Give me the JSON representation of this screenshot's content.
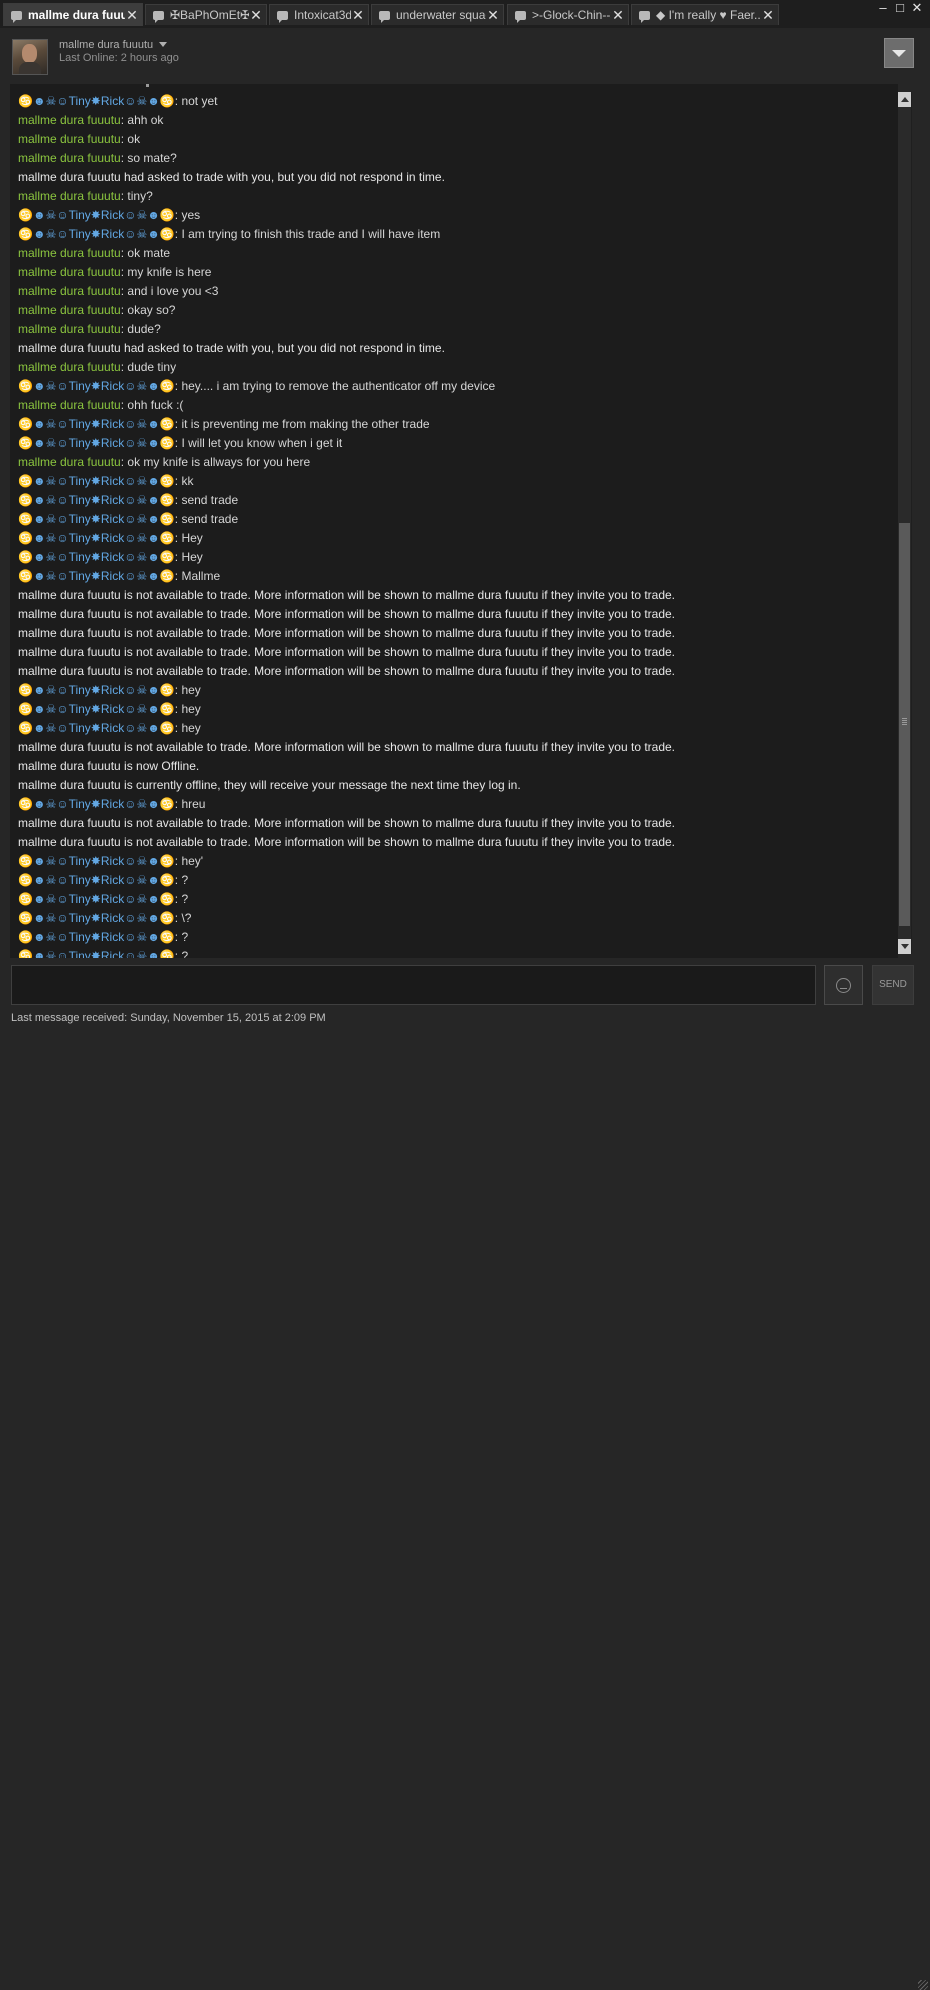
{
  "tabs": [
    {
      "label": "mallme dura fuuutu",
      "active": true
    },
    {
      "label": "✠BaPhOmEt✠",
      "active": false
    },
    {
      "label": "Intoxicat3d",
      "active": false
    },
    {
      "label": "underwater squad",
      "active": false
    },
    {
      "label": ">-Glock-Chin-->",
      "active": false
    },
    {
      "label": "◆ I'm really ♥ Faer...",
      "active": false
    }
  ],
  "window": {
    "minimize": "–",
    "maximize": "□",
    "close": "✕"
  },
  "header": {
    "friend_name": "mallme dura fuuutu",
    "last_online": "Last Online: 2 hours ago"
  },
  "speakers": {
    "friend": "mallme dura fuuutu",
    "me": "♋☻☠☺Tiny✸Rick☺☠☻♋"
  },
  "colors": {
    "friend_name": "#8bc53f",
    "self_name": "#62a7e3",
    "message_text": "#d6d6d6",
    "background": "#1c1c1c"
  },
  "messages": [
    {
      "type": "me",
      "text": ": not yet"
    },
    {
      "type": "friend",
      "text": ": ahh ok"
    },
    {
      "type": "friend",
      "text": ": ok"
    },
    {
      "type": "friend",
      "text": ": so mate?"
    },
    {
      "type": "event",
      "text": "mallme dura fuuutu had asked to trade with you, but you did not respond in time."
    },
    {
      "type": "friend",
      "text": ": tiny?"
    },
    {
      "type": "me",
      "text": ": yes"
    },
    {
      "type": "me",
      "text": ": I am trying to finish this trade and I will have item"
    },
    {
      "type": "friend",
      "text": ": ok mate"
    },
    {
      "type": "friend",
      "text": ": my knife is here"
    },
    {
      "type": "friend",
      "text": ": and i love you <3"
    },
    {
      "type": "friend",
      "text": ": okay so?"
    },
    {
      "type": "friend",
      "text": ": dude?"
    },
    {
      "type": "event",
      "text": "mallme dura fuuutu had asked to trade with you, but you did not respond in time."
    },
    {
      "type": "friend",
      "text": ": dude tiny"
    },
    {
      "type": "me",
      "text": ": hey.... i am trying to remove the authenticator off my device"
    },
    {
      "type": "friend",
      "text": ": ohh fuck :("
    },
    {
      "type": "me",
      "text": ": it is  preventing me from making the other trade"
    },
    {
      "type": "me",
      "text": ": I will let you know when i get it"
    },
    {
      "type": "friend",
      "text": ": ok my knife is allways for you here"
    },
    {
      "type": "me",
      "text": ": kk"
    },
    {
      "type": "me",
      "text": ": send trade"
    },
    {
      "type": "me",
      "text": ": send trade"
    },
    {
      "type": "me",
      "text": ": Hey"
    },
    {
      "type": "me",
      "text": ": Hey"
    },
    {
      "type": "me",
      "text": ": Mallme"
    },
    {
      "type": "event",
      "text": "mallme dura fuuutu is not available to trade. More information will be shown to mallme dura fuuutu if they invite you to trade."
    },
    {
      "type": "event",
      "text": "mallme dura fuuutu is not available to trade. More information will be shown to mallme dura fuuutu if they invite you to trade."
    },
    {
      "type": "event",
      "text": "mallme dura fuuutu is not available to trade. More information will be shown to mallme dura fuuutu if they invite you to trade."
    },
    {
      "type": "event",
      "text": "mallme dura fuuutu is not available to trade. More information will be shown to mallme dura fuuutu if they invite you to trade."
    },
    {
      "type": "event",
      "text": "mallme dura fuuutu is not available to trade. More information will be shown to mallme dura fuuutu if they invite you to trade."
    },
    {
      "type": "me",
      "text": ": hey"
    },
    {
      "type": "me",
      "text": ": hey"
    },
    {
      "type": "me",
      "text": ": hey"
    },
    {
      "type": "event",
      "text": "mallme dura fuuutu is not available to trade. More information will be shown to mallme dura fuuutu if they invite you to trade."
    },
    {
      "type": "event",
      "text": "mallme dura fuuutu is now Offline."
    },
    {
      "type": "event",
      "text": "mallme dura fuuutu is currently offline, they will receive your message the next time they log in."
    },
    {
      "type": "me",
      "text": ": hreu"
    },
    {
      "type": "event",
      "text": "mallme dura fuuutu is not available to trade. More information will be shown to mallme dura fuuutu if they invite you to trade."
    },
    {
      "type": "event",
      "text": "mallme dura fuuutu is not available to trade. More information will be shown to mallme dura fuuutu if they invite you to trade."
    },
    {
      "type": "me",
      "text": ": hey'"
    },
    {
      "type": "me",
      "text": ": ?"
    },
    {
      "type": "me",
      "text": ": ?"
    },
    {
      "type": "me",
      "text": ": \\?"
    },
    {
      "type": "me",
      "text": ": ?"
    },
    {
      "type": "me",
      "text": ": ?"
    }
  ],
  "input": {
    "value": "",
    "placeholder": ""
  },
  "send_label": "SEND",
  "emoticon_icon": "emoticon-icon",
  "footer": {
    "last_received": "Last message received: Sunday, November 15, 2015 at 2:09 PM"
  }
}
